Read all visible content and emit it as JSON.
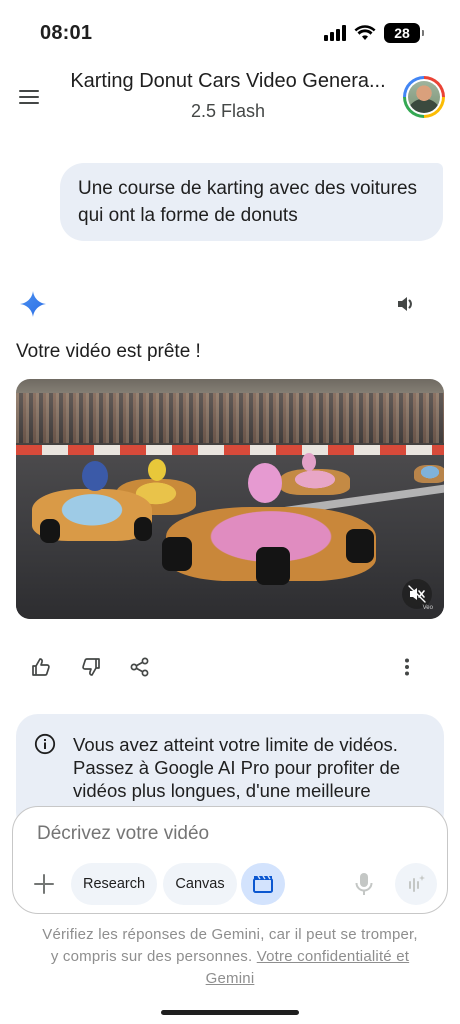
{
  "status_bar": {
    "time": "08:01",
    "battery": "28"
  },
  "header": {
    "title": "Karting Donut Cars Video Genera...",
    "model": "2.5 Flash"
  },
  "conversation": {
    "user_prompt": "Une course de karting avec des voitures qui ont la forme de donuts",
    "response_text": "Votre vidéo est prête !",
    "video_badge": "Veo"
  },
  "info_card": {
    "text": "Vous avez atteint votre limite de vidéos. Passez à Google AI Pro pour profiter de vidéos plus longues, d'une meilleure"
  },
  "composer": {
    "placeholder": "Décrivez votre vidéo",
    "chips": {
      "research": "Research",
      "canvas": "Canvas"
    }
  },
  "disclaimer": {
    "text": "Vérifiez les réponses de Gemini, car il peut se tromper, y compris sur des personnes.",
    "link": "Votre confidentialité et Gemini"
  },
  "colors": {
    "accent": "#1a73e8",
    "bubble": "#e9eef6",
    "video_chip": "#d3e3fd"
  }
}
